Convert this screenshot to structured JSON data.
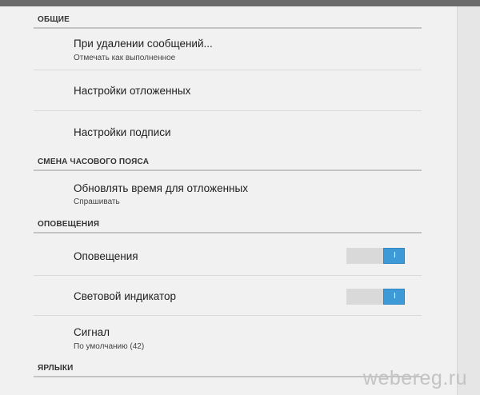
{
  "sections": {
    "general": {
      "header": "ОБЩИЕ",
      "delete": {
        "title": "При удалении сообщений...",
        "subtitle": "Отмечать как выполненное"
      },
      "deferred": {
        "title": "Настройки отложенных"
      },
      "signature": {
        "title": "Настройки подписи"
      }
    },
    "timezone": {
      "header": "СМЕНА ЧАСОВОГО ПОЯСА",
      "update": {
        "title": "Обновлять время для отложенных",
        "subtitle": "Спрашивать"
      }
    },
    "notifications": {
      "header": "ОПОВЕЩЕНИЯ",
      "notify": {
        "title": "Оповещения",
        "toggle_label": "I",
        "enabled": true
      },
      "led": {
        "title": "Световой индикатор",
        "toggle_label": "I",
        "enabled": true
      },
      "sound": {
        "title": "Сигнал",
        "subtitle": "По умолчанию (42)"
      }
    },
    "labels": {
      "header": "ЯРЛЫКИ"
    }
  },
  "watermark": "webereg.ru",
  "colors": {
    "accent": "#3d9ad6",
    "divider": "#c4c4c4",
    "background": "#f1f1f1"
  }
}
